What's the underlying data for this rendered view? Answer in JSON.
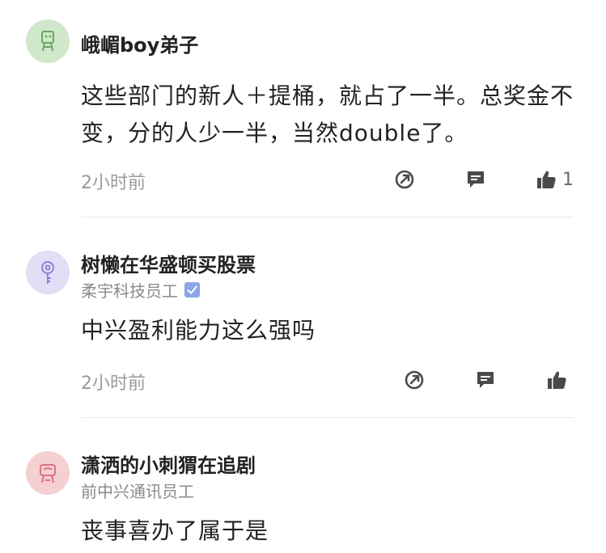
{
  "comments": [
    {
      "username": "峨嵋boy弟子",
      "badge": "",
      "verified": false,
      "content": "这些部门的新人＋提桶，就占了一半。总奖金不变，分的人少一半，当然double了。",
      "time": "2小时前",
      "like_count": "1",
      "avatar_color": "#cfe8c9"
    },
    {
      "username": "树懒在华盛顿买股票",
      "badge": "柔宇科技员工",
      "verified": true,
      "content": "中兴盈利能力这么强吗",
      "time": "2小时前",
      "like_count": "",
      "avatar_color": "#e3def6"
    },
    {
      "username": "潇洒的小刺猬在追剧",
      "badge": "前中兴通讯员工",
      "verified": false,
      "content": "丧事喜办了属于是",
      "time": "",
      "like_count": "",
      "avatar_color": "#f5d0d3"
    }
  ],
  "icons": {
    "share": "share-icon",
    "reply": "reply-icon",
    "like": "thumbs-up-icon"
  },
  "colors": {
    "icon": "#4a4a4a",
    "meta_text": "#9a9a9a",
    "divider": "#e8e8e8"
  }
}
